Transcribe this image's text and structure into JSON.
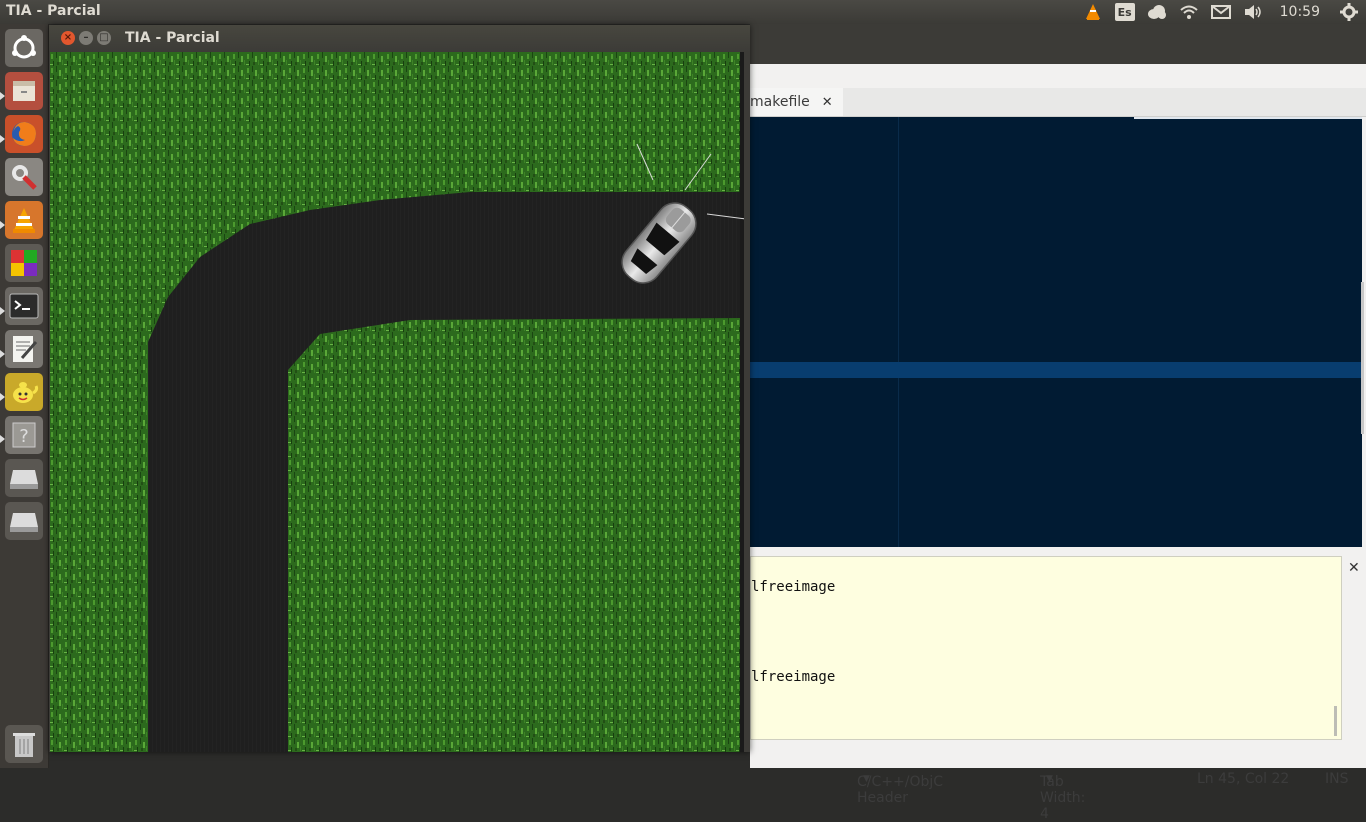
{
  "top_panel": {
    "title": "TIA - Parcial",
    "keyboard_layout": "Es",
    "clock": "10:59"
  },
  "game_window": {
    "title": "TIA - Parcial"
  },
  "editor": {
    "tab_label": "makefile",
    "output_lines": [
      "lfreeimage",
      "lfreeimage"
    ],
    "status": {
      "language": "C/C++/ObjC Header",
      "tab_width": "Tab Width:  4",
      "position": "Ln 45, Col 22",
      "mode": "INS"
    }
  },
  "launcher_items": [
    {
      "name": "dash-home-icon"
    },
    {
      "name": "files-icon"
    },
    {
      "name": "firefox-icon"
    },
    {
      "name": "system-settings-icon"
    },
    {
      "name": "vlc-icon"
    },
    {
      "name": "workspaces-icon"
    },
    {
      "name": "terminal-icon"
    },
    {
      "name": "text-editor-icon"
    },
    {
      "name": "teapot-app-icon"
    },
    {
      "name": "unknown-app-icon"
    },
    {
      "name": "drive-icon"
    },
    {
      "name": "drive-icon-2"
    },
    {
      "name": "trash-icon"
    }
  ],
  "colors": {
    "grass": "#2d6a1e",
    "road": "#1e1e1e",
    "editor_bg": "#011b33",
    "output_bg": "#fefee0"
  }
}
